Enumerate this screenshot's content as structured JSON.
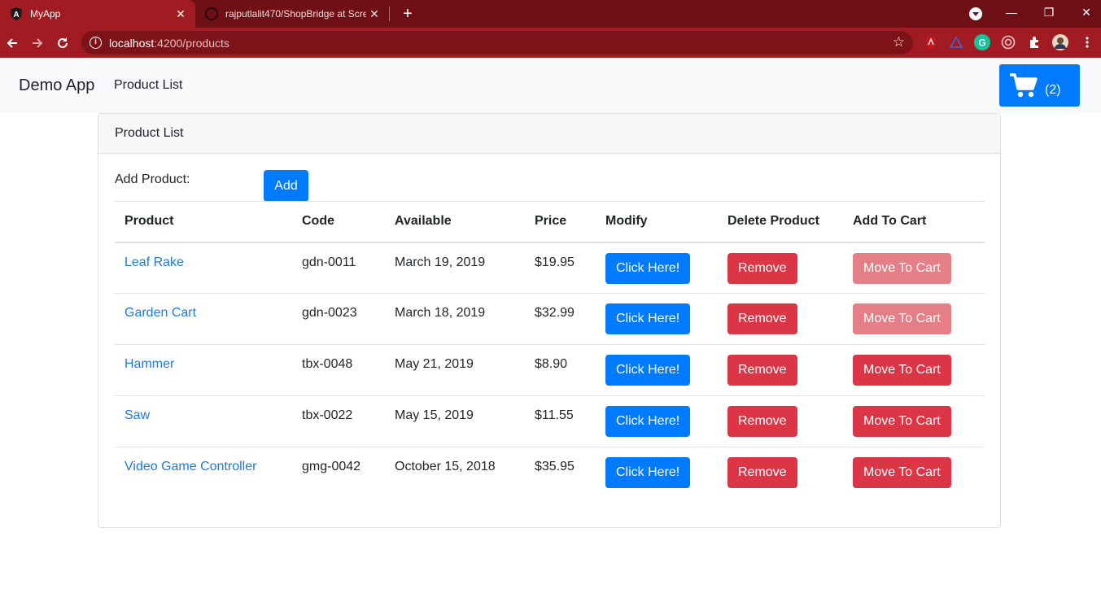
{
  "browser": {
    "tabs": [
      {
        "title": "MyApp",
        "active": true
      },
      {
        "title": "rajputlalit470/ShopBridge at Scre",
        "active": false
      }
    ],
    "address": {
      "host": "localhost",
      "path": ":4200/products"
    }
  },
  "navbar": {
    "brand": "Demo App",
    "link": "Product List",
    "cart_count": "(2)"
  },
  "card": {
    "header": "Product List",
    "add_label": "Add Product:",
    "add_button": "Add"
  },
  "table": {
    "headers": [
      "Product",
      "Code",
      "Available",
      "Price",
      "Modify",
      "Delete Product",
      "Add To Cart"
    ],
    "rows": [
      {
        "name": "Leaf Rake",
        "code": "gdn-0011",
        "available": "March 19, 2019",
        "price": "$19.95",
        "modify": "Click Here!",
        "delete": "Remove",
        "cart": "Move To Cart",
        "cart_disabled": true
      },
      {
        "name": "Garden Cart",
        "code": "gdn-0023",
        "available": "March 18, 2019",
        "price": "$32.99",
        "modify": "Click Here!",
        "delete": "Remove",
        "cart": "Move To Cart",
        "cart_disabled": true
      },
      {
        "name": "Hammer",
        "code": "tbx-0048",
        "available": "May 21, 2019",
        "price": "$8.90",
        "modify": "Click Here!",
        "delete": "Remove",
        "cart": "Move To Cart",
        "cart_disabled": false
      },
      {
        "name": "Saw",
        "code": "tbx-0022",
        "available": "May 15, 2019",
        "price": "$11.55",
        "modify": "Click Here!",
        "delete": "Remove",
        "cart": "Move To Cart",
        "cart_disabled": false
      },
      {
        "name": "Video Game Controller",
        "code": "gmg-0042",
        "available": "October 15, 2018",
        "price": "$35.95",
        "modify": "Click Here!",
        "delete": "Remove",
        "cart": "Move To Cart",
        "cart_disabled": false
      }
    ]
  },
  "colors": {
    "primary": "#007bff",
    "danger": "#dc3545",
    "danger_disabled": "#e47f88",
    "link": "#1f7ad8",
    "browser_frame": "#a11c22"
  }
}
